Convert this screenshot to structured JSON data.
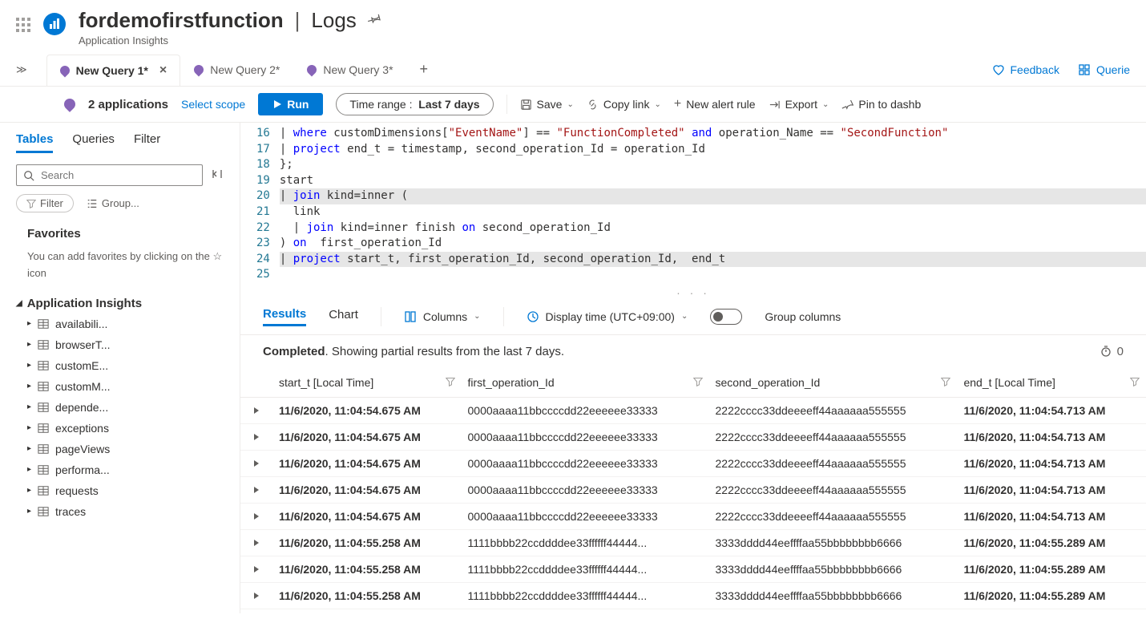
{
  "header": {
    "resource": "fordemofirstfunction",
    "page": "Logs",
    "subtitle": "Application Insights"
  },
  "tabs": [
    {
      "label": "New Query 1*",
      "active": true
    },
    {
      "label": "New Query 2*",
      "active": false
    },
    {
      "label": "New Query 3*",
      "active": false
    }
  ],
  "tabbar_right": {
    "feedback": "Feedback",
    "queries": "Querie"
  },
  "toolbar": {
    "apps": "2 applications",
    "scope": "Select scope",
    "run": "Run",
    "timerange_label": "Time range :",
    "timerange_value": "Last 7 days",
    "save": "Save",
    "copy": "Copy link",
    "alert": "New alert rule",
    "export": "Export",
    "pin": "Pin to dashb"
  },
  "sidebar": {
    "tabs": {
      "tables": "Tables",
      "queries": "Queries",
      "filter": "Filter"
    },
    "search_placeholder": "Search",
    "filter_btn": "Filter",
    "group_btn": "Group...",
    "favorites_title": "Favorites",
    "favorites_text": "You can add favorites by clicking on the ☆ icon",
    "tree_header": "Application Insights",
    "tree": [
      "availabili...",
      "browserT...",
      "customE...",
      "customM...",
      "depende...",
      "exceptions",
      "pageViews",
      "performa...",
      "requests",
      "traces"
    ]
  },
  "editor": {
    "lines": [
      {
        "n": 16,
        "tokens": [
          {
            "t": "| ",
            "c": ""
          },
          {
            "t": "where",
            "c": "kw"
          },
          {
            "t": " customDimensions[",
            "c": ""
          },
          {
            "t": "\"EventName\"",
            "c": "str"
          },
          {
            "t": "] == ",
            "c": ""
          },
          {
            "t": "\"FunctionCompleted\"",
            "c": "str"
          },
          {
            "t": " ",
            "c": ""
          },
          {
            "t": "and",
            "c": "kw"
          },
          {
            "t": " operation_Name == ",
            "c": ""
          },
          {
            "t": "\"SecondFunction\"",
            "c": "str"
          }
        ]
      },
      {
        "n": 17,
        "tokens": [
          {
            "t": "| ",
            "c": ""
          },
          {
            "t": "project",
            "c": "kw"
          },
          {
            "t": " end_t = timestamp, second_operation_Id = operation_Id",
            "c": ""
          }
        ]
      },
      {
        "n": 18,
        "tokens": [
          {
            "t": "};",
            "c": ""
          }
        ]
      },
      {
        "n": 19,
        "tokens": [
          {
            "t": "start",
            "c": ""
          }
        ]
      },
      {
        "n": 20,
        "hl": true,
        "tokens": [
          {
            "t": "| ",
            "c": ""
          },
          {
            "t": "join",
            "c": "kw"
          },
          {
            "t": " kind=inner (",
            "c": ""
          }
        ]
      },
      {
        "n": 21,
        "tokens": [
          {
            "t": "  link",
            "c": ""
          }
        ]
      },
      {
        "n": 22,
        "tokens": [
          {
            "t": "  | ",
            "c": ""
          },
          {
            "t": "join",
            "c": "kw"
          },
          {
            "t": " kind=inner finish ",
            "c": ""
          },
          {
            "t": "on",
            "c": "kw"
          },
          {
            "t": " second_operation_Id",
            "c": ""
          }
        ]
      },
      {
        "n": 23,
        "tokens": [
          {
            "t": ") ",
            "c": ""
          },
          {
            "t": "on",
            "c": "kw"
          },
          {
            "t": "  first_operation_Id",
            "c": ""
          }
        ]
      },
      {
        "n": 24,
        "hl": true,
        "tokens": [
          {
            "t": "| ",
            "c": ""
          },
          {
            "t": "project",
            "c": "kw"
          },
          {
            "t": " start_t, first_operation_Id, second_operation_Id,  end_t",
            "c": ""
          }
        ]
      },
      {
        "n": 25,
        "tokens": [
          {
            "t": "",
            "c": ""
          }
        ]
      }
    ]
  },
  "results": {
    "tabs": {
      "results": "Results",
      "chart": "Chart"
    },
    "columns_btn": "Columns",
    "display_time": "Display time (UTC+09:00)",
    "group_cols": "Group columns",
    "status_bold": "Completed",
    "status_rest": ". Showing partial results from the last 7 days.",
    "headers": [
      "start_t [Local Time]",
      "first_operation_Id",
      "second_operation_Id",
      "end_t [Local Time]"
    ],
    "rows": [
      [
        "11/6/2020, 11:04:54.675 AM",
        "0000aaaa11bbccccdd22eeeeee33333",
        "2222cccc33ddeeeeff44aaaaaa555555",
        "11/6/2020, 11:04:54.713 AM"
      ],
      [
        "11/6/2020, 11:04:54.675 AM",
        "0000aaaa11bbccccdd22eeeeee33333",
        "2222cccc33ddeeeeff44aaaaaa555555",
        "11/6/2020, 11:04:54.713 AM"
      ],
      [
        "11/6/2020, 11:04:54.675 AM",
        "0000aaaa11bbccccdd22eeeeee33333",
        "2222cccc33ddeeeeff44aaaaaa555555",
        "11/6/2020, 11:04:54.713 AM"
      ],
      [
        "11/6/2020, 11:04:54.675 AM",
        "0000aaaa11bbccccdd22eeeeee33333",
        "2222cccc33ddeeeeff44aaaaaa555555",
        "11/6/2020, 11:04:54.713 AM"
      ],
      [
        "11/6/2020, 11:04:54.675 AM",
        "0000aaaa11bbccccdd22eeeeee33333",
        "2222cccc33ddeeeeff44aaaaaa555555",
        "11/6/2020, 11:04:54.713 AM"
      ],
      [
        "11/6/2020, 11:04:55.258 AM",
        "1111bbbb22ccddddee33ffffff44444...",
        "3333dddd44eeffffaa55bbbbbbbb6666",
        "11/6/2020, 11:04:55.289 AM"
      ],
      [
        "11/6/2020, 11:04:55.258 AM",
        "1111bbbb22ccddddee33ffffff44444...",
        "3333dddd44eeffffaa55bbbbbbbb6666",
        "11/6/2020, 11:04:55.289 AM"
      ],
      [
        "11/6/2020, 11:04:55.258 AM",
        "1111bbbb22ccddddee33ffffff44444...",
        "3333dddd44eeffffaa55bbbbbbbb6666",
        "11/6/2020, 11:04:55.289 AM"
      ]
    ]
  }
}
